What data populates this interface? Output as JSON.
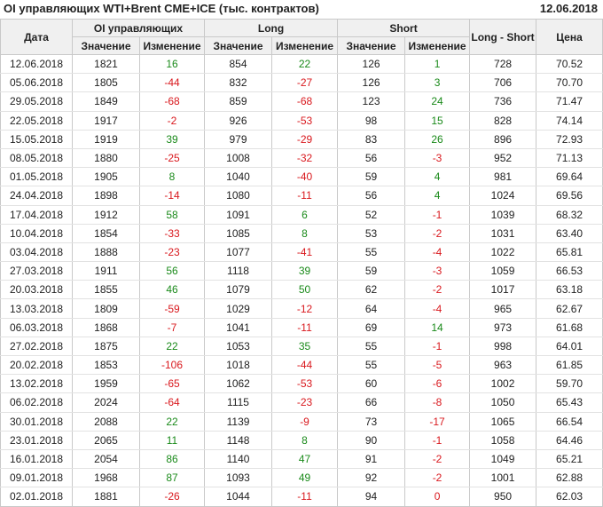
{
  "header": {
    "title": "OI управляющих WTI+Brent CME+ICE (тыс. контрактов)",
    "date": "12.06.2018"
  },
  "columns": {
    "date": "Дата",
    "oi_group": "OI управляющих",
    "long_group": "Long",
    "short_group": "Short",
    "long_short": "Long - Short",
    "price": "Цена",
    "value": "Значение",
    "change": "Изменение"
  },
  "colors": {
    "positive": "#1a8a1a",
    "negative": "#d9191e",
    "header_bg": "#f0f0f0"
  },
  "rows": [
    {
      "date": "12.06.2018",
      "oi": "1821",
      "oi_chg": "16",
      "long": "854",
      "long_chg": "22",
      "short": "126",
      "short_chg": "1",
      "ls": "728",
      "price": "70.52"
    },
    {
      "date": "05.06.2018",
      "oi": "1805",
      "oi_chg": "-44",
      "long": "832",
      "long_chg": "-27",
      "short": "126",
      "short_chg": "3",
      "ls": "706",
      "price": "70.70"
    },
    {
      "date": "29.05.2018",
      "oi": "1849",
      "oi_chg": "-68",
      "long": "859",
      "long_chg": "-68",
      "short": "123",
      "short_chg": "24",
      "ls": "736",
      "price": "71.47"
    },
    {
      "date": "22.05.2018",
      "oi": "1917",
      "oi_chg": "-2",
      "long": "926",
      "long_chg": "-53",
      "short": "98",
      "short_chg": "15",
      "ls": "828",
      "price": "74.14"
    },
    {
      "date": "15.05.2018",
      "oi": "1919",
      "oi_chg": "39",
      "long": "979",
      "long_chg": "-29",
      "short": "83",
      "short_chg": "26",
      "ls": "896",
      "price": "72.93"
    },
    {
      "date": "08.05.2018",
      "oi": "1880",
      "oi_chg": "-25",
      "long": "1008",
      "long_chg": "-32",
      "short": "56",
      "short_chg": "-3",
      "ls": "952",
      "price": "71.13"
    },
    {
      "date": "01.05.2018",
      "oi": "1905",
      "oi_chg": "8",
      "long": "1040",
      "long_chg": "-40",
      "short": "59",
      "short_chg": "4",
      "ls": "981",
      "price": "69.64"
    },
    {
      "date": "24.04.2018",
      "oi": "1898",
      "oi_chg": "-14",
      "long": "1080",
      "long_chg": "-11",
      "short": "56",
      "short_chg": "4",
      "ls": "1024",
      "price": "69.56"
    },
    {
      "date": "17.04.2018",
      "oi": "1912",
      "oi_chg": "58",
      "long": "1091",
      "long_chg": "6",
      "short": "52",
      "short_chg": "-1",
      "ls": "1039",
      "price": "68.32"
    },
    {
      "date": "10.04.2018",
      "oi": "1854",
      "oi_chg": "-33",
      "long": "1085",
      "long_chg": "8",
      "short": "53",
      "short_chg": "-2",
      "ls": "1031",
      "price": "63.40"
    },
    {
      "date": "03.04.2018",
      "oi": "1888",
      "oi_chg": "-23",
      "long": "1077",
      "long_chg": "-41",
      "short": "55",
      "short_chg": "-4",
      "ls": "1022",
      "price": "65.81"
    },
    {
      "date": "27.03.2018",
      "oi": "1911",
      "oi_chg": "56",
      "long": "1118",
      "long_chg": "39",
      "short": "59",
      "short_chg": "-3",
      "ls": "1059",
      "price": "66.53"
    },
    {
      "date": "20.03.2018",
      "oi": "1855",
      "oi_chg": "46",
      "long": "1079",
      "long_chg": "50",
      "short": "62",
      "short_chg": "-2",
      "ls": "1017",
      "price": "63.18"
    },
    {
      "date": "13.03.2018",
      "oi": "1809",
      "oi_chg": "-59",
      "long": "1029",
      "long_chg": "-12",
      "short": "64",
      "short_chg": "-4",
      "ls": "965",
      "price": "62.67"
    },
    {
      "date": "06.03.2018",
      "oi": "1868",
      "oi_chg": "-7",
      "long": "1041",
      "long_chg": "-11",
      "short": "69",
      "short_chg": "14",
      "ls": "973",
      "price": "61.68"
    },
    {
      "date": "27.02.2018",
      "oi": "1875",
      "oi_chg": "22",
      "long": "1053",
      "long_chg": "35",
      "short": "55",
      "short_chg": "-1",
      "ls": "998",
      "price": "64.01"
    },
    {
      "date": "20.02.2018",
      "oi": "1853",
      "oi_chg": "-106",
      "long": "1018",
      "long_chg": "-44",
      "short": "55",
      "short_chg": "-5",
      "ls": "963",
      "price": "61.85"
    },
    {
      "date": "13.02.2018",
      "oi": "1959",
      "oi_chg": "-65",
      "long": "1062",
      "long_chg": "-53",
      "short": "60",
      "short_chg": "-6",
      "ls": "1002",
      "price": "59.70"
    },
    {
      "date": "06.02.2018",
      "oi": "2024",
      "oi_chg": "-64",
      "long": "1115",
      "long_chg": "-23",
      "short": "66",
      "short_chg": "-8",
      "ls": "1050",
      "price": "65.43"
    },
    {
      "date": "30.01.2018",
      "oi": "2088",
      "oi_chg": "22",
      "long": "1139",
      "long_chg": "-9",
      "short": "73",
      "short_chg": "-17",
      "ls": "1065",
      "price": "66.54"
    },
    {
      "date": "23.01.2018",
      "oi": "2065",
      "oi_chg": "11",
      "long": "1148",
      "long_chg": "8",
      "short": "90",
      "short_chg": "-1",
      "ls": "1058",
      "price": "64.46"
    },
    {
      "date": "16.01.2018",
      "oi": "2054",
      "oi_chg": "86",
      "long": "1140",
      "long_chg": "47",
      "short": "91",
      "short_chg": "-2",
      "ls": "1049",
      "price": "65.21"
    },
    {
      "date": "09.01.2018",
      "oi": "1968",
      "oi_chg": "87",
      "long": "1093",
      "long_chg": "49",
      "short": "92",
      "short_chg": "-2",
      "ls": "1001",
      "price": "62.88"
    },
    {
      "date": "02.01.2018",
      "oi": "1881",
      "oi_chg": "-26",
      "long": "1044",
      "long_chg": "-11",
      "short": "94",
      "short_chg": "0",
      "ls": "950",
      "price": "62.03"
    }
  ]
}
